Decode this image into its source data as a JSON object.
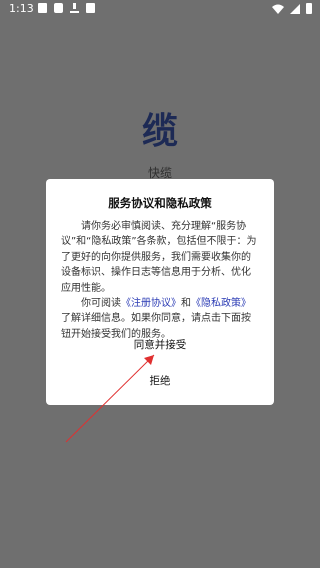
{
  "status_bar": {
    "time": "1:13",
    "icons_left": [
      "image-icon",
      "square-icon",
      "download-icon",
      "a-icon"
    ],
    "icons_right": [
      "wifi-icon",
      "signal-icon",
      "battery-icon"
    ]
  },
  "app": {
    "logo_text": "缆",
    "name": "快缆"
  },
  "dialog": {
    "title": "服务协议和隐私政策",
    "paragraph1": "请你务必审慎阅读、充分理解“服务协议”和“隐私政策”各条款，包括但不限于：为了更好的向你提供服务，我们需要收集你的设备标识、操作日志等信息用于分析、优化应用性能。",
    "paragraph2_prefix": "你可阅读",
    "link_terms": "《注册协议》",
    "paragraph2_and": "和",
    "link_privacy": "《隐私政策》",
    "paragraph2_suffix": "了解详细信息。如果你同意，请点击下面按钮开始接受我们的服务。",
    "agree_label": "同意并接受",
    "reject_label": "拒绝"
  },
  "colors": {
    "overlay": "#6f6f6f",
    "link": "#2d3db5",
    "logo": "#1d2a55",
    "arrow": "#e03030"
  }
}
